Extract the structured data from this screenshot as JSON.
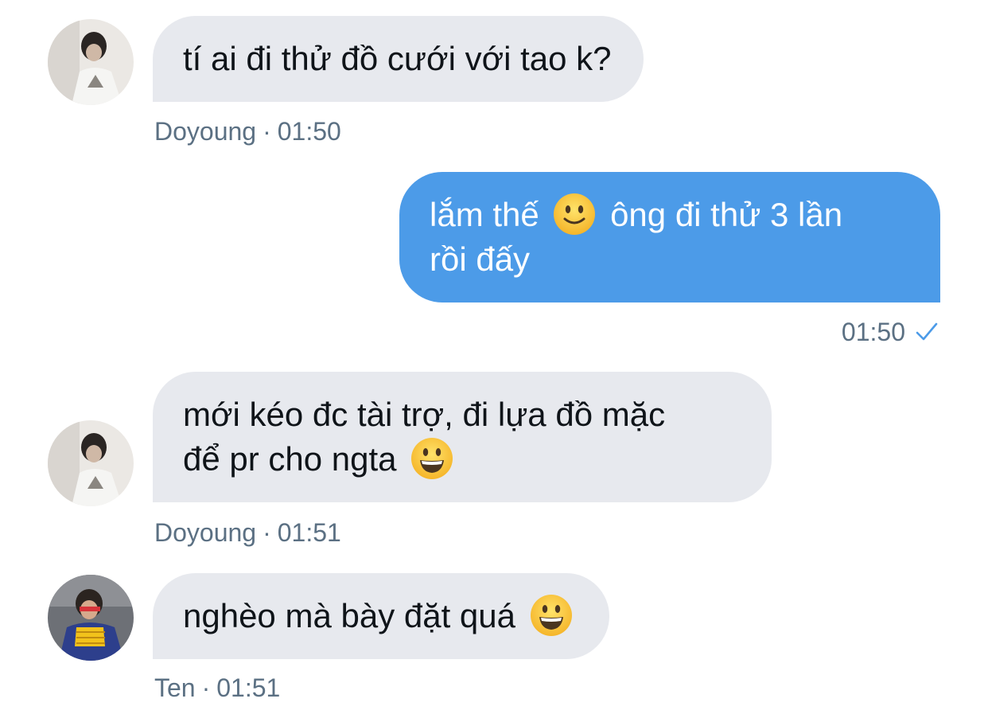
{
  "messages": [
    {
      "direction": "in",
      "sender": "Doyoung",
      "time": "01:50",
      "lines": [
        "tí ai đi thử đồ cưới với tao k?"
      ],
      "avatar": "doyoung-avatar"
    },
    {
      "direction": "out",
      "time": "01:50",
      "lines_part": {
        "before_emoji": "lắm thế",
        "after_emoji": "ông đi thử 3 lần",
        "line2": "rồi đấy"
      },
      "emoji": "slightly-smiling-face",
      "status": "sent-check-icon"
    },
    {
      "direction": "in",
      "sender": "Doyoung",
      "time": "01:51",
      "lines": [
        "mới kéo đc tài trợ, đi lựa đồ mặc",
        "để pr cho ngta"
      ],
      "emoji": "grinning-face",
      "avatar": "doyoung-avatar"
    },
    {
      "direction": "in",
      "sender": "Ten",
      "time": "01:51",
      "lines": [
        "nghèo mà bày đặt quá"
      ],
      "emoji": "grinning-face",
      "avatar": "ten-avatar"
    }
  ],
  "separator": "·",
  "colors": {
    "incoming_bubble": "#e7e9ee",
    "outgoing_bubble": "#4c9be8",
    "meta_text": "#5b7083",
    "check": "#4c9be8"
  }
}
